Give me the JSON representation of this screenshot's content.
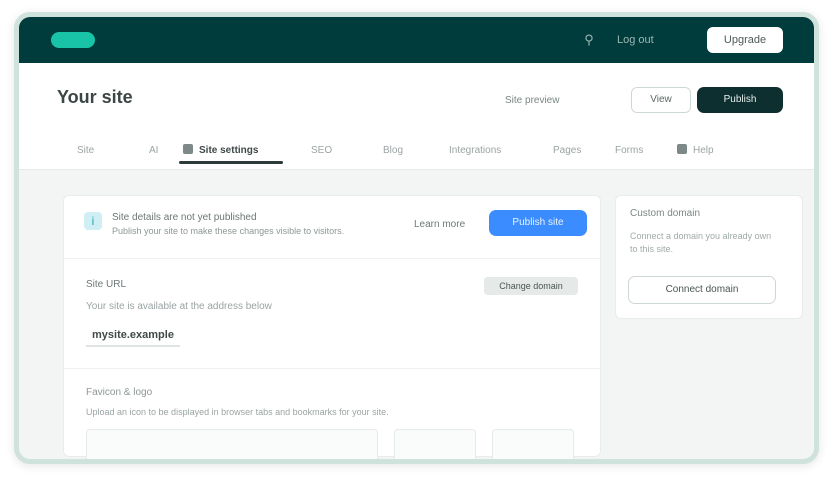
{
  "topbar": {
    "search_icon": "search-icon",
    "nav_link": "Log out",
    "cta_label": "Upgrade"
  },
  "header": {
    "title": "Your site",
    "meta": "Site preview",
    "secondary_button": "View",
    "primary_button": "Publish"
  },
  "tabs": [
    {
      "label": "Site",
      "active": false
    },
    {
      "label": "AI",
      "active": false
    },
    {
      "label": "Site settings",
      "active": true
    },
    {
      "label": "SEO",
      "active": false
    },
    {
      "label": "Blog",
      "active": false
    },
    {
      "label": "Integrations",
      "active": false
    },
    {
      "label": "Pages",
      "active": false
    },
    {
      "label": "Forms",
      "active": false
    },
    {
      "label": "Help",
      "active": false
    }
  ],
  "banner": {
    "line1": "Site details are not yet published",
    "line2": "Publish your site to make these changes visible to visitors.",
    "link": "Learn more",
    "button": "Publish site"
  },
  "section1": {
    "title": "Site URL",
    "action": "Change domain",
    "description": "Your site is available at the address below",
    "value": "mysite.example"
  },
  "section2": {
    "title": "Favicon & logo",
    "description": "Upload an icon to be displayed in browser tabs and bookmarks for your site."
  },
  "side": {
    "title": "Custom domain",
    "description": "Connect a domain you already own to this site.",
    "button": "Connect domain"
  },
  "colors": {
    "topbar": "#003c3c",
    "accent": "#19c3a8",
    "primary_blue": "#3b8cff"
  }
}
